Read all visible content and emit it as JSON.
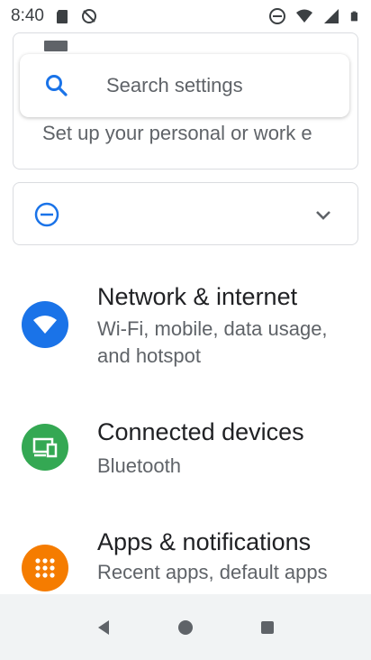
{
  "status_bar": {
    "time": "8:40",
    "left_icons": [
      "sd-card-icon",
      "sync-disabled-icon"
    ],
    "right_icons": [
      "do-not-disturb-icon",
      "wifi-icon",
      "signal-icon",
      "battery-icon"
    ]
  },
  "search": {
    "placeholder": "Search settings"
  },
  "peek_card": {
    "text": "Set up your personal or work e"
  },
  "suggestion": {
    "icon": "do-not-disturb-icon",
    "expand_icon": "chevron-down-icon"
  },
  "items": [
    {
      "title": "Network & internet",
      "subtitle": "Wi-Fi, mobile, data usage, and hotspot",
      "icon": "wifi-icon",
      "color": "#1a73e8"
    },
    {
      "title": "Connected devices",
      "subtitle": "Bluetooth",
      "icon": "devices-icon",
      "color": "#34a853"
    },
    {
      "title": "Apps & notifications",
      "subtitle": "Recent apps, default apps",
      "icon": "apps-icon",
      "color": "#f57c00"
    }
  ],
  "nav": [
    "back-icon",
    "home-icon",
    "recents-icon"
  ],
  "colors": {
    "accent": "#1a73e8",
    "background": "#ffffff",
    "nav_bar": "#f1f3f4"
  }
}
